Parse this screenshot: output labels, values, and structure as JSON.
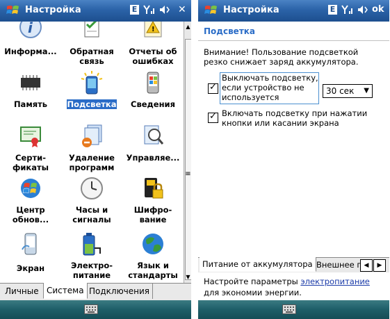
{
  "left": {
    "title": "Настройка",
    "status": {
      "edge": "E",
      "signal": "Y",
      "volume": "◀€",
      "close": "✕"
    },
    "items": [
      {
        "label": "Информа...",
        "icon": "info-icon"
      },
      {
        "label": "Обратная связь",
        "icon": "feedback-icon"
      },
      {
        "label": "Отчеты об ошибках",
        "icon": "error-report-icon"
      },
      {
        "label": "Память",
        "icon": "memory-chip-icon"
      },
      {
        "label": "Подсветка",
        "icon": "backlight-icon"
      },
      {
        "label": "Сведения",
        "icon": "about-device-icon"
      },
      {
        "label": "Серти- фикаты",
        "icon": "certificates-icon"
      },
      {
        "label": "Удаление программ",
        "icon": "remove-programs-icon"
      },
      {
        "label": "Управляе...",
        "icon": "managed-programs-icon"
      },
      {
        "label": "Центр обнов...",
        "icon": "update-center-icon"
      },
      {
        "label": "Часы и сигналы",
        "icon": "clock-icon"
      },
      {
        "label": "Шифро- вание",
        "icon": "encryption-icon"
      },
      {
        "label": "Экран",
        "icon": "screen-icon"
      },
      {
        "label": "Электро- питание",
        "icon": "power-icon"
      },
      {
        "label": "Язык и стандарты",
        "icon": "regional-settings-icon"
      }
    ],
    "tabs": [
      "Личные",
      "Система",
      "Подключения"
    ],
    "active_tab": "Система"
  },
  "right": {
    "title": "Настройка",
    "status": {
      "edge": "E",
      "signal": "Y",
      "volume": "◀€",
      "ok": "ok"
    },
    "heading": "Подсветка",
    "warning": "Внимание! Пользование подсветкой резко снижает заряд аккумулятора.",
    "option1": {
      "label": "Выключать подсветку, если устройство не используется",
      "checked": true
    },
    "timeout": "30 сек",
    "option2": {
      "label": "Включать подсветку при нажатии кнопки или касании экрана",
      "checked": true
    },
    "tabs": [
      "Питание от аккумулятора",
      "Внешнее пит"
    ],
    "hint_prefix": "Настройте параметры ",
    "hint_link": "электропитание",
    "hint_suffix": "для экономии энергии."
  }
}
